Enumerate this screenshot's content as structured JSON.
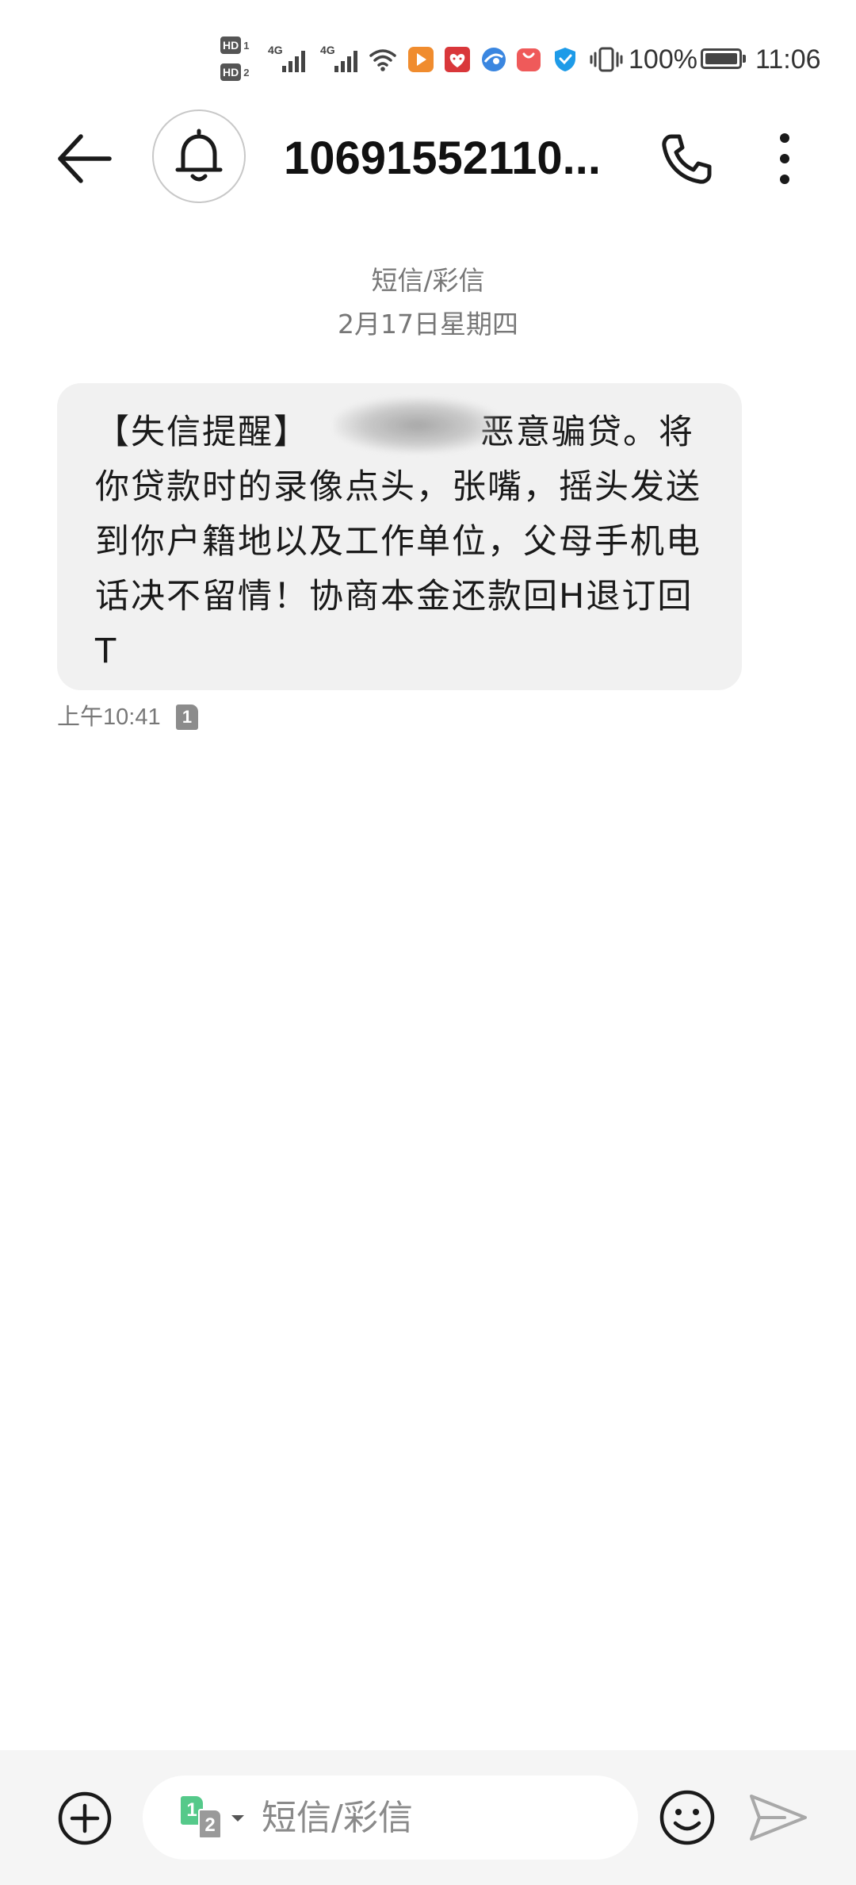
{
  "status_bar": {
    "sim1_tag": "HD",
    "sim1_num": "1",
    "sim2_tag": "HD",
    "sim2_num": "2",
    "network1": "4G",
    "network2": "4G",
    "icons": [
      "wifi-icon",
      "video-app-icon",
      "heart-app-icon",
      "browser-app-icon",
      "shop-app-icon",
      "shield-app-icon",
      "vibrate-icon"
    ],
    "battery": "100%",
    "time": "11:06"
  },
  "app_bar": {
    "contact": "10691552110...",
    "icons": [
      "back-arrow-icon",
      "bell-icon",
      "phone-icon",
      "more-vertical-icon"
    ]
  },
  "conversation": {
    "channel": "短信/彩信",
    "date": "2月17日星期四",
    "message": {
      "text_before_redaction": "【失信提醒】",
      "text_after_redaction": "恶意骗贷。将你贷款时的录像点头，张嘴，摇头发送到你户籍地以及工作单位，父母手机电话决不留情！协商本金还款回H退订回T",
      "time": "上午10:41",
      "sim": "1"
    }
  },
  "composer": {
    "sim_primary": "1",
    "sim_secondary": "2",
    "placeholder": "短信/彩信",
    "icons": [
      "add-circle-icon",
      "emoji-icon",
      "send-icon"
    ]
  },
  "colors": {
    "bubble_bg": "#f1f1f1",
    "composer_bg": "#f5f5f5",
    "sim1_green": "#55c98a",
    "secondary_text": "#777777"
  }
}
